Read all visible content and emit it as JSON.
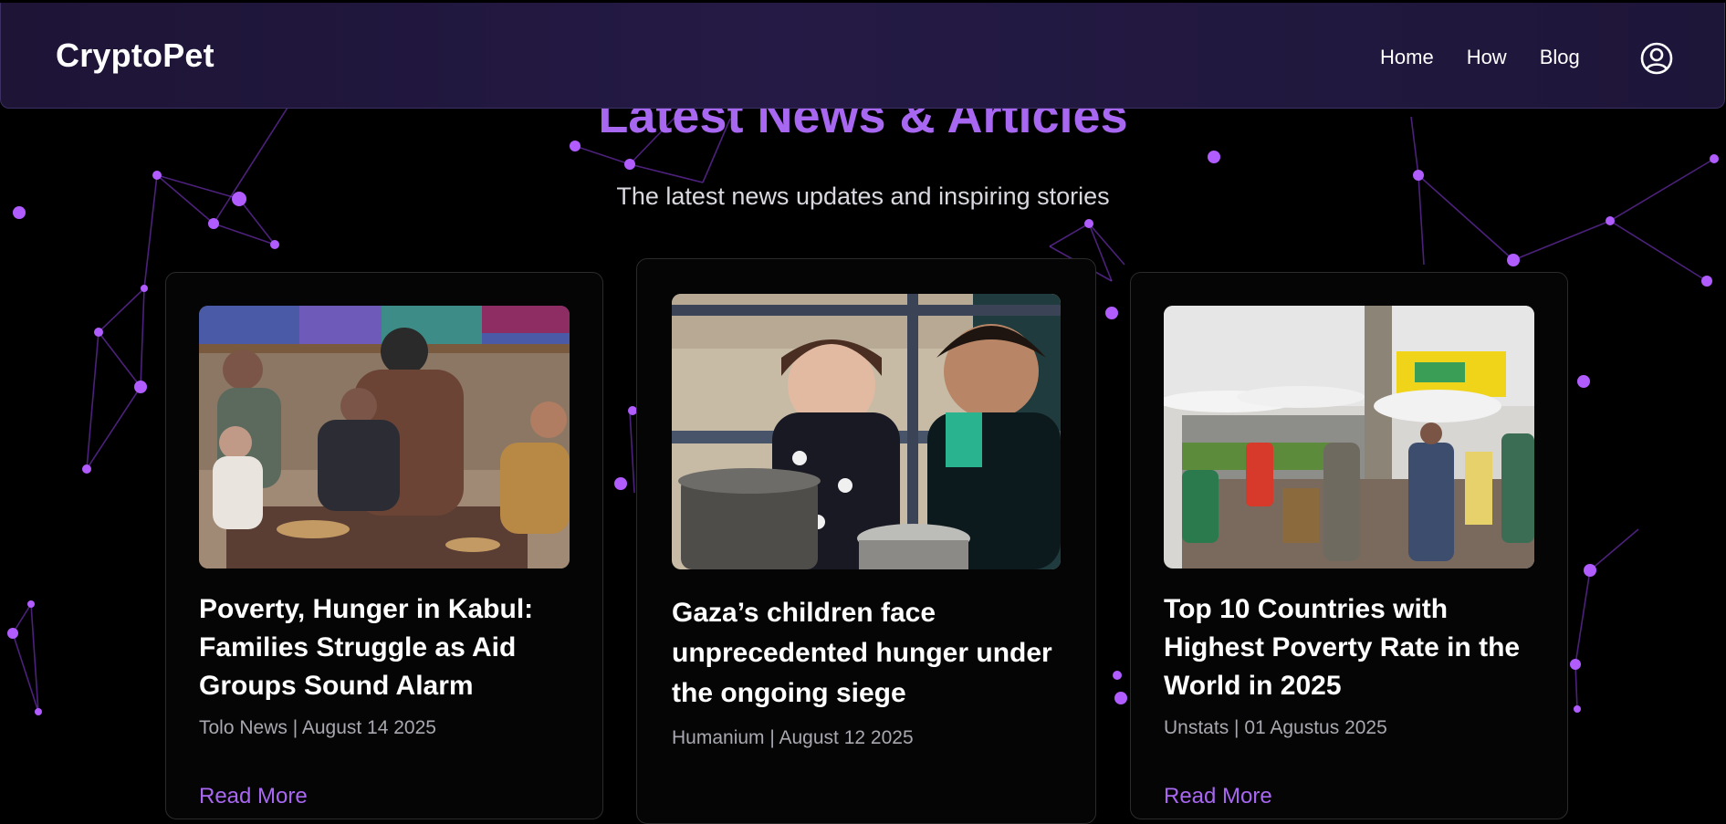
{
  "header": {
    "logo": "CryptoPet",
    "nav": [
      "Home",
      "How",
      "Blog"
    ],
    "user_icon": "user-circle-icon"
  },
  "section": {
    "title": "Latest News & Articles",
    "subtitle": "The latest news updates and inspiring stories"
  },
  "articles": [
    {
      "title": "Poverty, Hunger in Kabul: Families Struggle as Aid Groups Sound Alarm",
      "meta": "Tolo News | August 14 2025",
      "read_more": "Read More",
      "image": "family-sharing-food-photo"
    },
    {
      "title": "Gaza’s children face unprecedented hunger under the ongoing siege",
      "meta": "Humanium | August 12 2025",
      "read_more": "",
      "image": "children-at-food-distribution-photo"
    },
    {
      "title": "Top 10 Countries with Highest Poverty Rate in the World in 2025",
      "meta": "Unstats | 01 Agustus 2025",
      "read_more": "Read More",
      "image": "street-market-photo"
    }
  ],
  "colors": {
    "accent": "#a867f0",
    "background": "#000000",
    "navbar": "#221a40",
    "network": "#b05cff"
  }
}
